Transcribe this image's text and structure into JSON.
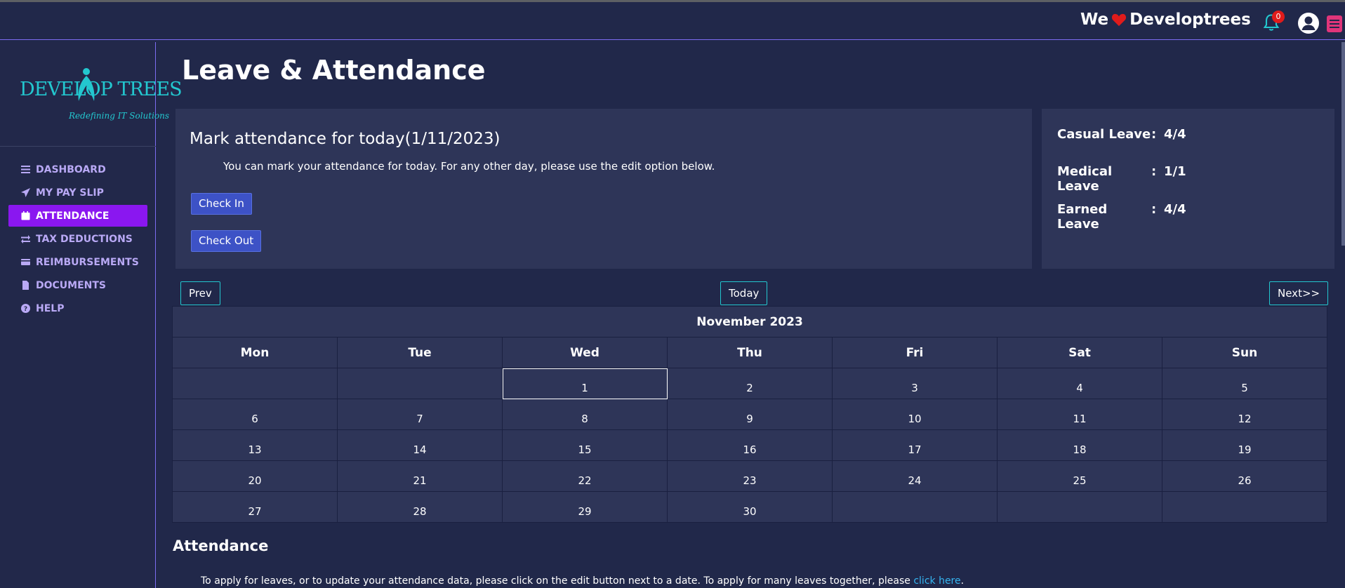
{
  "header": {
    "we_text": "We",
    "brand_text": "Developtrees",
    "notification_count": "0",
    "colors": {
      "heart": "#e01b1b",
      "bell": "#23c7cf",
      "menu": "#e0357a"
    }
  },
  "sidebar": {
    "logo": {
      "main": "DEVELOP TREES",
      "tagline": "Redefining IT Solutions"
    },
    "items": [
      {
        "label": "DASHBOARD",
        "icon": "list-icon",
        "active": false
      },
      {
        "label": "MY PAY SLIP",
        "icon": "send-icon",
        "active": false
      },
      {
        "label": "ATTENDANCE",
        "icon": "calendar-icon",
        "active": true
      },
      {
        "label": "TAX DEDUCTIONS",
        "icon": "exchange-icon",
        "active": false
      },
      {
        "label": "REIMBURSEMENTS",
        "icon": "credit-card-icon",
        "active": false
      },
      {
        "label": "DOCUMENTS",
        "icon": "file-icon",
        "active": false
      },
      {
        "label": "HELP",
        "icon": "question-circle-icon",
        "active": false
      }
    ]
  },
  "main": {
    "title": "Leave & Attendance",
    "attendance_panel": {
      "heading": "Mark attendance for today(1/11/2023)",
      "description": "You can mark your attendance for today. For any other day, please use the edit option below.",
      "check_in_label": "Check In",
      "check_out_label": "Check Out"
    },
    "leave_panel": {
      "rows": [
        {
          "name": "Casual Leave",
          "sep": ":",
          "value": "4/4"
        },
        {
          "name": "Medical Leave",
          "sep": ":",
          "value": "1/1"
        },
        {
          "name": "Earned Leave",
          "sep": ":",
          "value": "4/4"
        }
      ]
    },
    "calendar": {
      "prev_label": "Prev",
      "today_label": "Today",
      "next_label": "Next>>",
      "month_label": "November 2023",
      "weekdays": [
        "Mon",
        "Tue",
        "Wed",
        "Thu",
        "Fri",
        "Sat",
        "Sun"
      ],
      "weeks": [
        [
          "",
          "",
          "1",
          "2",
          "3",
          "4",
          "5"
        ],
        [
          "6",
          "7",
          "8",
          "9",
          "10",
          "11",
          "12"
        ],
        [
          "13",
          "14",
          "15",
          "16",
          "17",
          "18",
          "19"
        ],
        [
          "20",
          "21",
          "22",
          "23",
          "24",
          "25",
          "26"
        ],
        [
          "27",
          "28",
          "29",
          "30",
          "",
          "",
          ""
        ]
      ],
      "today_day": "1"
    },
    "attendance_section": {
      "title": "Attendance",
      "note_text": "To apply for leaves, or to update your attendance data, please click on the edit button next to a date. To apply for many leaves together, please",
      "link_text": "click here",
      "note_end": "."
    }
  }
}
